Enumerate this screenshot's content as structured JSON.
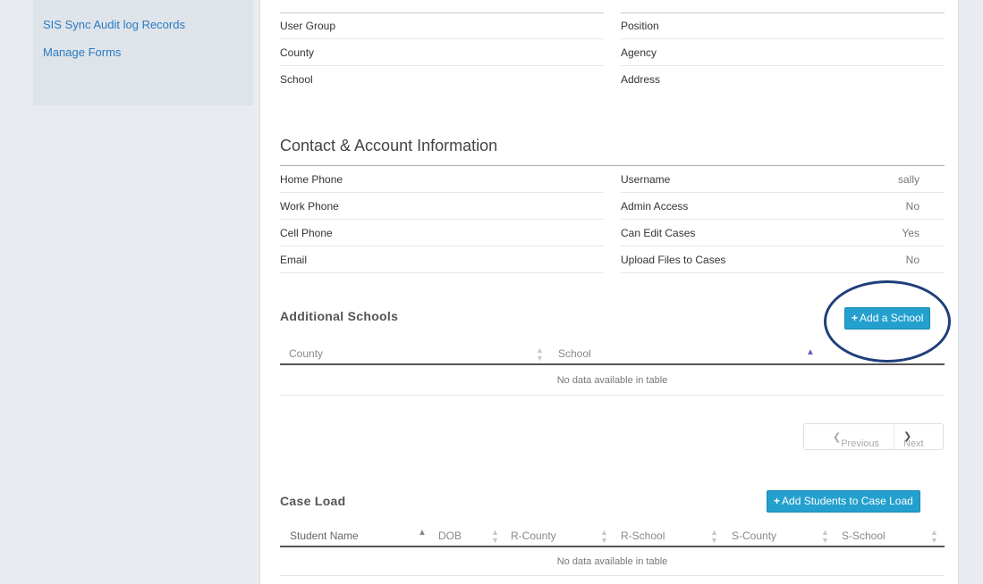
{
  "sidebar": {
    "items": [
      {
        "label": "SIS Sync Audit log Records"
      },
      {
        "label": "Manage Forms"
      }
    ]
  },
  "profile": {
    "left_rows": [
      "User Group",
      "County",
      "School"
    ],
    "right_rows": [
      "Position",
      "Agency",
      "Address"
    ]
  },
  "contact": {
    "title": "Contact & Account Information",
    "left_rows": [
      "Home Phone",
      "Work Phone",
      "Cell Phone",
      "Email"
    ],
    "right_rows": [
      {
        "label": "Username",
        "value": "sally"
      },
      {
        "label": "Admin Access",
        "value": "No"
      },
      {
        "label": "Can Edit Cases",
        "value": "Yes"
      },
      {
        "label": "Upload Files to Cases",
        "value": "No"
      }
    ]
  },
  "additional_schools": {
    "title": "Additional Schools",
    "add_button": "Add a School",
    "columns": [
      "County",
      "School"
    ],
    "empty_text": "No data available in table",
    "pager": {
      "previous": "Previous",
      "next": "Next"
    }
  },
  "case_load": {
    "title": "Case Load",
    "add_button": "Add Students to Case Load",
    "columns": [
      "Student Name",
      "DOB",
      "R-County",
      "R-School",
      "S-County",
      "S-School"
    ],
    "empty_text": "No data available in table"
  },
  "colors": {
    "accent": "#24a0ce",
    "link": "#2a7ac0",
    "highlight_oval": "#1f3f7a"
  }
}
